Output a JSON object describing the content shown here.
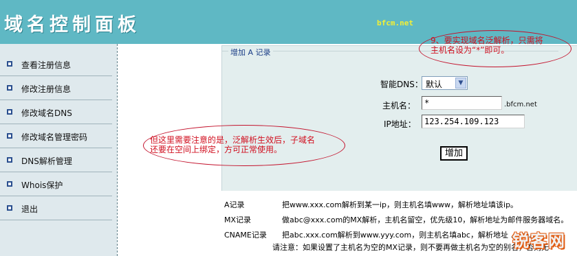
{
  "header": {
    "title": "域名控制面板",
    "domain": "bfcm.net"
  },
  "sidebar": {
    "items": [
      {
        "label": "查看注册信息"
      },
      {
        "label": "修改注册信息"
      },
      {
        "label": "修改域名DNS"
      },
      {
        "label": "修改域名管理密码"
      },
      {
        "label": "DNS解析管理"
      },
      {
        "label": "Whois保护"
      },
      {
        "label": "退出"
      }
    ]
  },
  "form": {
    "legend": "增加 A 记录",
    "dns_label": "智能DNS：",
    "dns_selected": "默认",
    "host_label": "主机名：",
    "host_value": "*",
    "host_suffix": ".bfcm.net",
    "ip_label": "IP地址：",
    "ip_value": "123.254.109.123",
    "submit_label": "增加"
  },
  "help": {
    "rows": [
      {
        "key": "A记录",
        "text": "把www.xxx.com解析到某一ip，则主机名填www，解析地址填该ip。"
      },
      {
        "key": "MX记录",
        "text": "做abc@xxx.com的MX解析，主机名留空，优先级10，解析地址为邮件服务器域名。"
      },
      {
        "key": "CNAME记录",
        "text": "把abc.xxx.com解析到www.yyy.com，则主机名填abc，解析地址 .com。"
      }
    ],
    "note": "请注意：如果设置了主机名为空的MX记录，则不要再做主机名为空的别名，否则无"
  },
  "annotations": {
    "top_right_line1": "9、要实现域名泛解析，只需将",
    "top_right_line2": "主机名设为“*”即可。",
    "middle_line1": "但这里需要注意的是，泛解析生效后，子域名",
    "middle_line2": "还要在空间上绑定，方可正常使用。"
  },
  "watermark": {
    "text": "锐客网"
  },
  "colors": {
    "header_bg": "#5fb8c4",
    "sidebar_bg": "#dfe9ed",
    "panel_bg": "#e3eeee",
    "annotation_red": "#d10f1f",
    "domain_yellow": "#f3ef35"
  }
}
